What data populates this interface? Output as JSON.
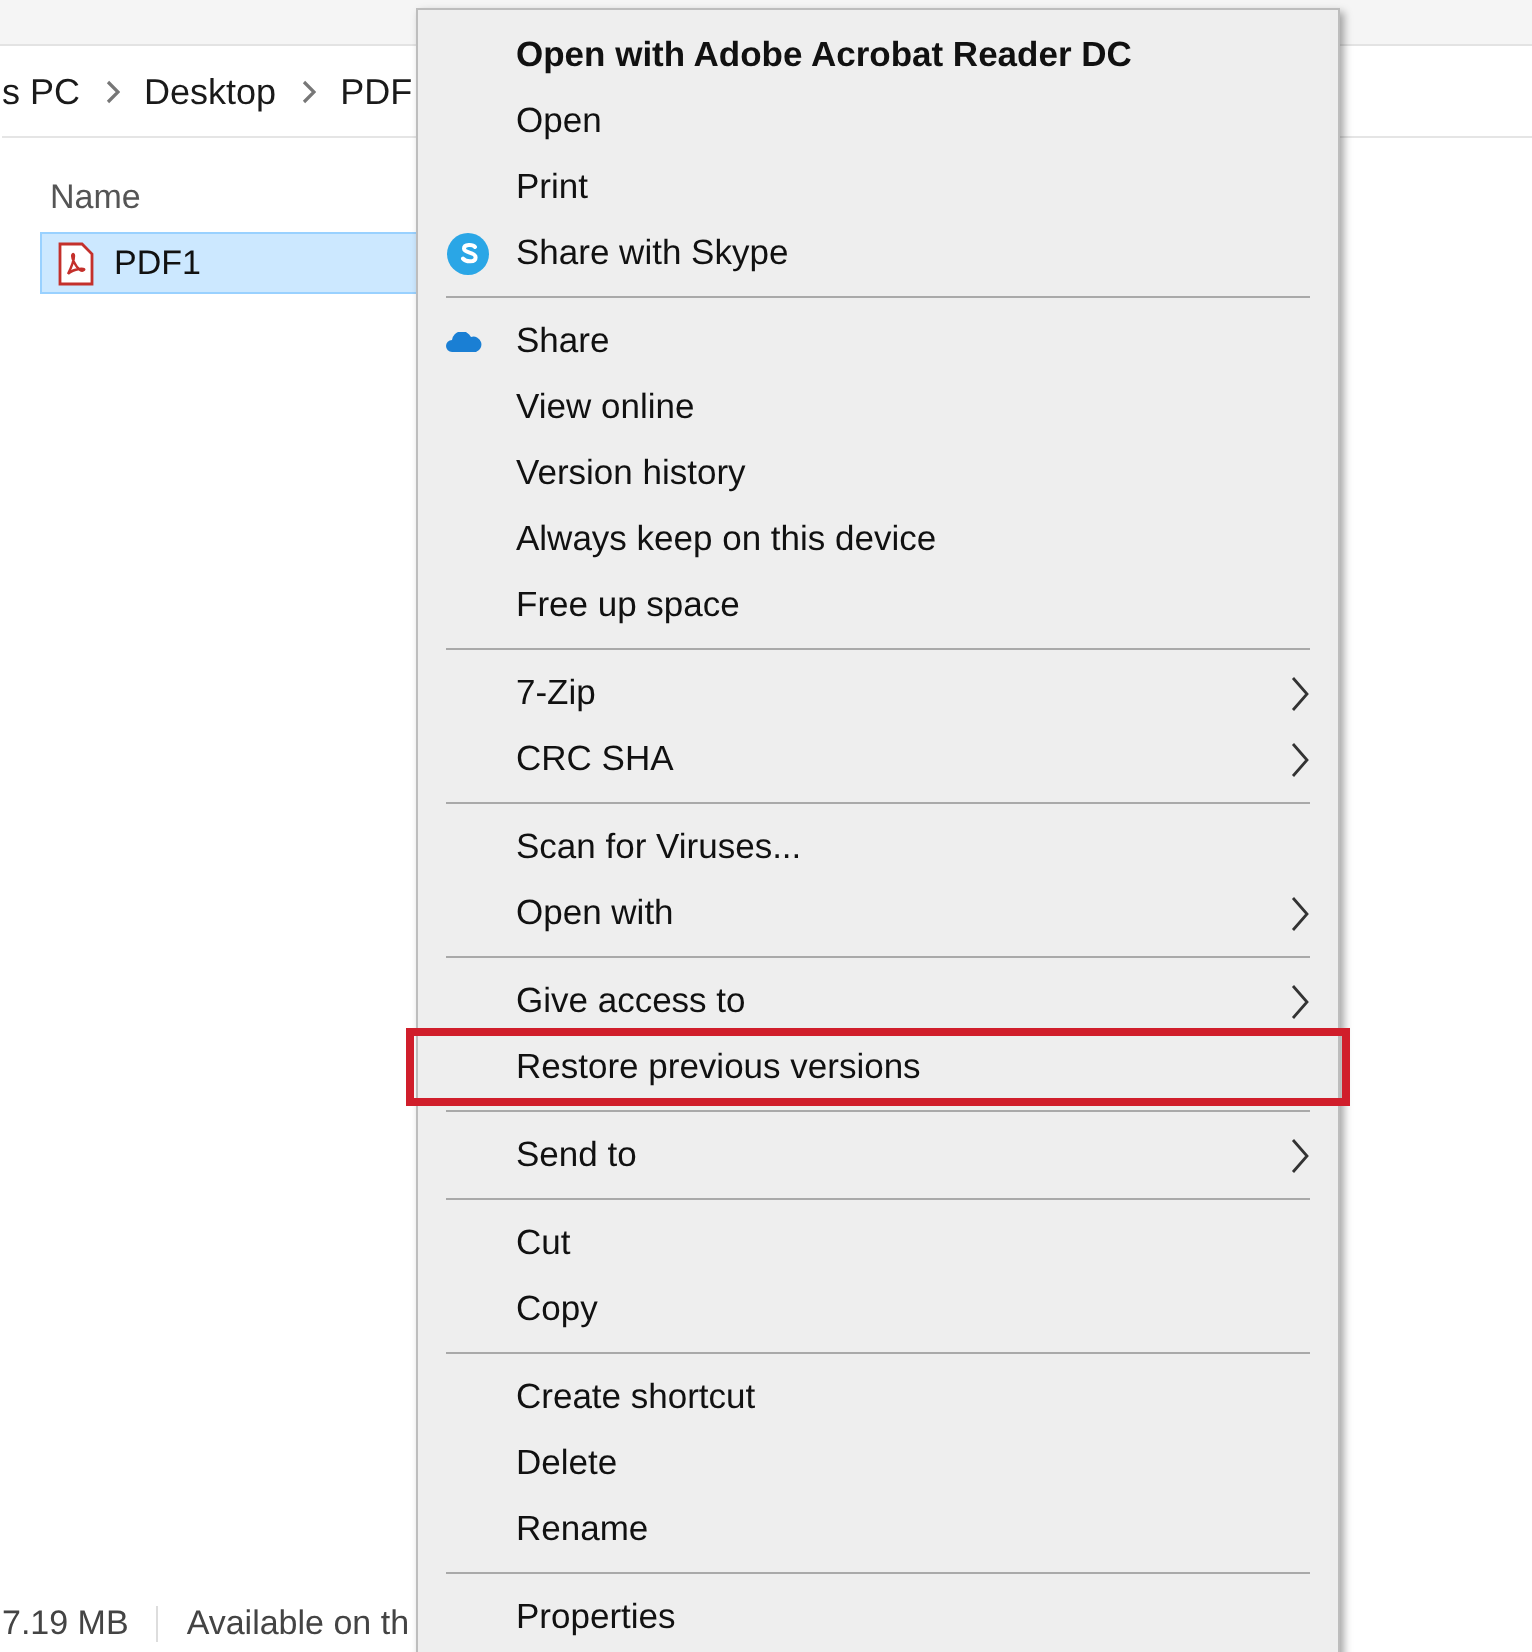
{
  "breadcrumb": [
    "s PC",
    "Desktop",
    "PDF"
  ],
  "file_list": {
    "column": "Name",
    "files": [
      {
        "name": "PDF1",
        "selected": true
      }
    ]
  },
  "status_bar": {
    "size": "7.19 MB",
    "availability": "Available on th"
  },
  "context_menu": {
    "groups": [
      [
        {
          "label": "Open with Adobe Acrobat Reader DC",
          "kind": "default",
          "submenu": false,
          "highlighted": false
        },
        {
          "label": "Open",
          "kind": "plain",
          "submenu": false,
          "highlighted": false
        },
        {
          "label": "Print",
          "kind": "plain",
          "submenu": false,
          "highlighted": false
        },
        {
          "label": "Share with Skype",
          "kind": "skype",
          "submenu": false,
          "highlighted": false
        }
      ],
      [
        {
          "label": "Share",
          "kind": "cloud",
          "submenu": false,
          "highlighted": false
        },
        {
          "label": "View online",
          "kind": "plain",
          "submenu": false,
          "highlighted": false
        },
        {
          "label": "Version history",
          "kind": "plain",
          "submenu": false,
          "highlighted": false
        },
        {
          "label": "Always keep on this device",
          "kind": "plain",
          "submenu": false,
          "highlighted": false
        },
        {
          "label": "Free up space",
          "kind": "plain",
          "submenu": false,
          "highlighted": false
        }
      ],
      [
        {
          "label": "7-Zip",
          "kind": "plain",
          "submenu": true,
          "highlighted": false
        },
        {
          "label": "CRC SHA",
          "kind": "plain",
          "submenu": true,
          "highlighted": false
        }
      ],
      [
        {
          "label": "Scan for Viruses...",
          "kind": "plain",
          "submenu": false,
          "highlighted": false
        },
        {
          "label": "Open with",
          "kind": "plain",
          "submenu": true,
          "highlighted": false
        }
      ],
      [
        {
          "label": "Give access to",
          "kind": "plain",
          "submenu": true,
          "highlighted": false
        },
        {
          "label": "Restore previous versions",
          "kind": "plain",
          "submenu": false,
          "highlighted": true
        }
      ],
      [
        {
          "label": "Send to",
          "kind": "plain",
          "submenu": true,
          "highlighted": false
        }
      ],
      [
        {
          "label": "Cut",
          "kind": "plain",
          "submenu": false,
          "highlighted": false
        },
        {
          "label": "Copy",
          "kind": "plain",
          "submenu": false,
          "highlighted": false
        }
      ],
      [
        {
          "label": "Create shortcut",
          "kind": "plain",
          "submenu": false,
          "highlighted": false
        },
        {
          "label": "Delete",
          "kind": "plain",
          "submenu": false,
          "highlighted": false
        },
        {
          "label": "Rename",
          "kind": "plain",
          "submenu": false,
          "highlighted": false
        }
      ],
      [
        {
          "label": "Properties",
          "kind": "plain",
          "submenu": false,
          "highlighted": false
        }
      ]
    ]
  }
}
